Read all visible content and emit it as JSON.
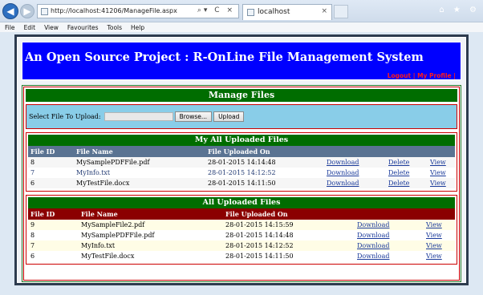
{
  "browser": {
    "url": "http://localhost:41206/ManageFile.aspx",
    "tab_title": "localhost",
    "tab_close": "×",
    "window_controls": "⌂ ★ ⚙",
    "address_tools": "⌕▾ C ×"
  },
  "menu": [
    "File",
    "Edit",
    "View",
    "Favourites",
    "Tools",
    "Help"
  ],
  "banner": {
    "title": "An Open Source Project : R-OnLine File Management System",
    "logout": "Logout",
    "separator": "|",
    "profile": "My Profile",
    "end": "|"
  },
  "manage": {
    "title": "Manage Files",
    "upload_label": "Select File To Upload:",
    "browse_label": "Browse...",
    "upload_button": "Upload"
  },
  "my_files": {
    "title": "My All Uploaded Files",
    "headers": [
      "File ID",
      "File Name",
      "File Uploaded On"
    ],
    "rows": [
      {
        "id": "8",
        "name": "MySamplePDFFile.pdf",
        "date": "28-01-2015 14:14:48",
        "download": "Download",
        "delete": "Delete",
        "view": "View"
      },
      {
        "id": "7",
        "name": "MyInfo.txt",
        "date": "28-01-2015 14:12:52",
        "download": "Download",
        "delete": "Delete",
        "view": "View"
      },
      {
        "id": "6",
        "name": "MyTestFile.docx",
        "date": "28-01-2015 14:11:50",
        "download": "Download",
        "delete": "Delete",
        "view": "View"
      }
    ]
  },
  "all_files": {
    "title": "All Uploaded Files",
    "headers": [
      "File ID",
      "File Name",
      "File Uploaded On"
    ],
    "rows": [
      {
        "id": "9",
        "name": "MySampleFile2.pdf",
        "date": "28-01-2015 14:15:59",
        "download": "Download",
        "view": "View"
      },
      {
        "id": "8",
        "name": "MySamplePDFFile.pdf",
        "date": "28-01-2015 14:14:48",
        "download": "Download",
        "view": "View"
      },
      {
        "id": "7",
        "name": "MyInfo.txt",
        "date": "28-01-2015 14:12:52",
        "download": "Download",
        "view": "View"
      },
      {
        "id": "6",
        "name": "MyTestFile.docx",
        "date": "28-01-2015 14:11:50",
        "download": "Download",
        "view": "View"
      }
    ]
  }
}
